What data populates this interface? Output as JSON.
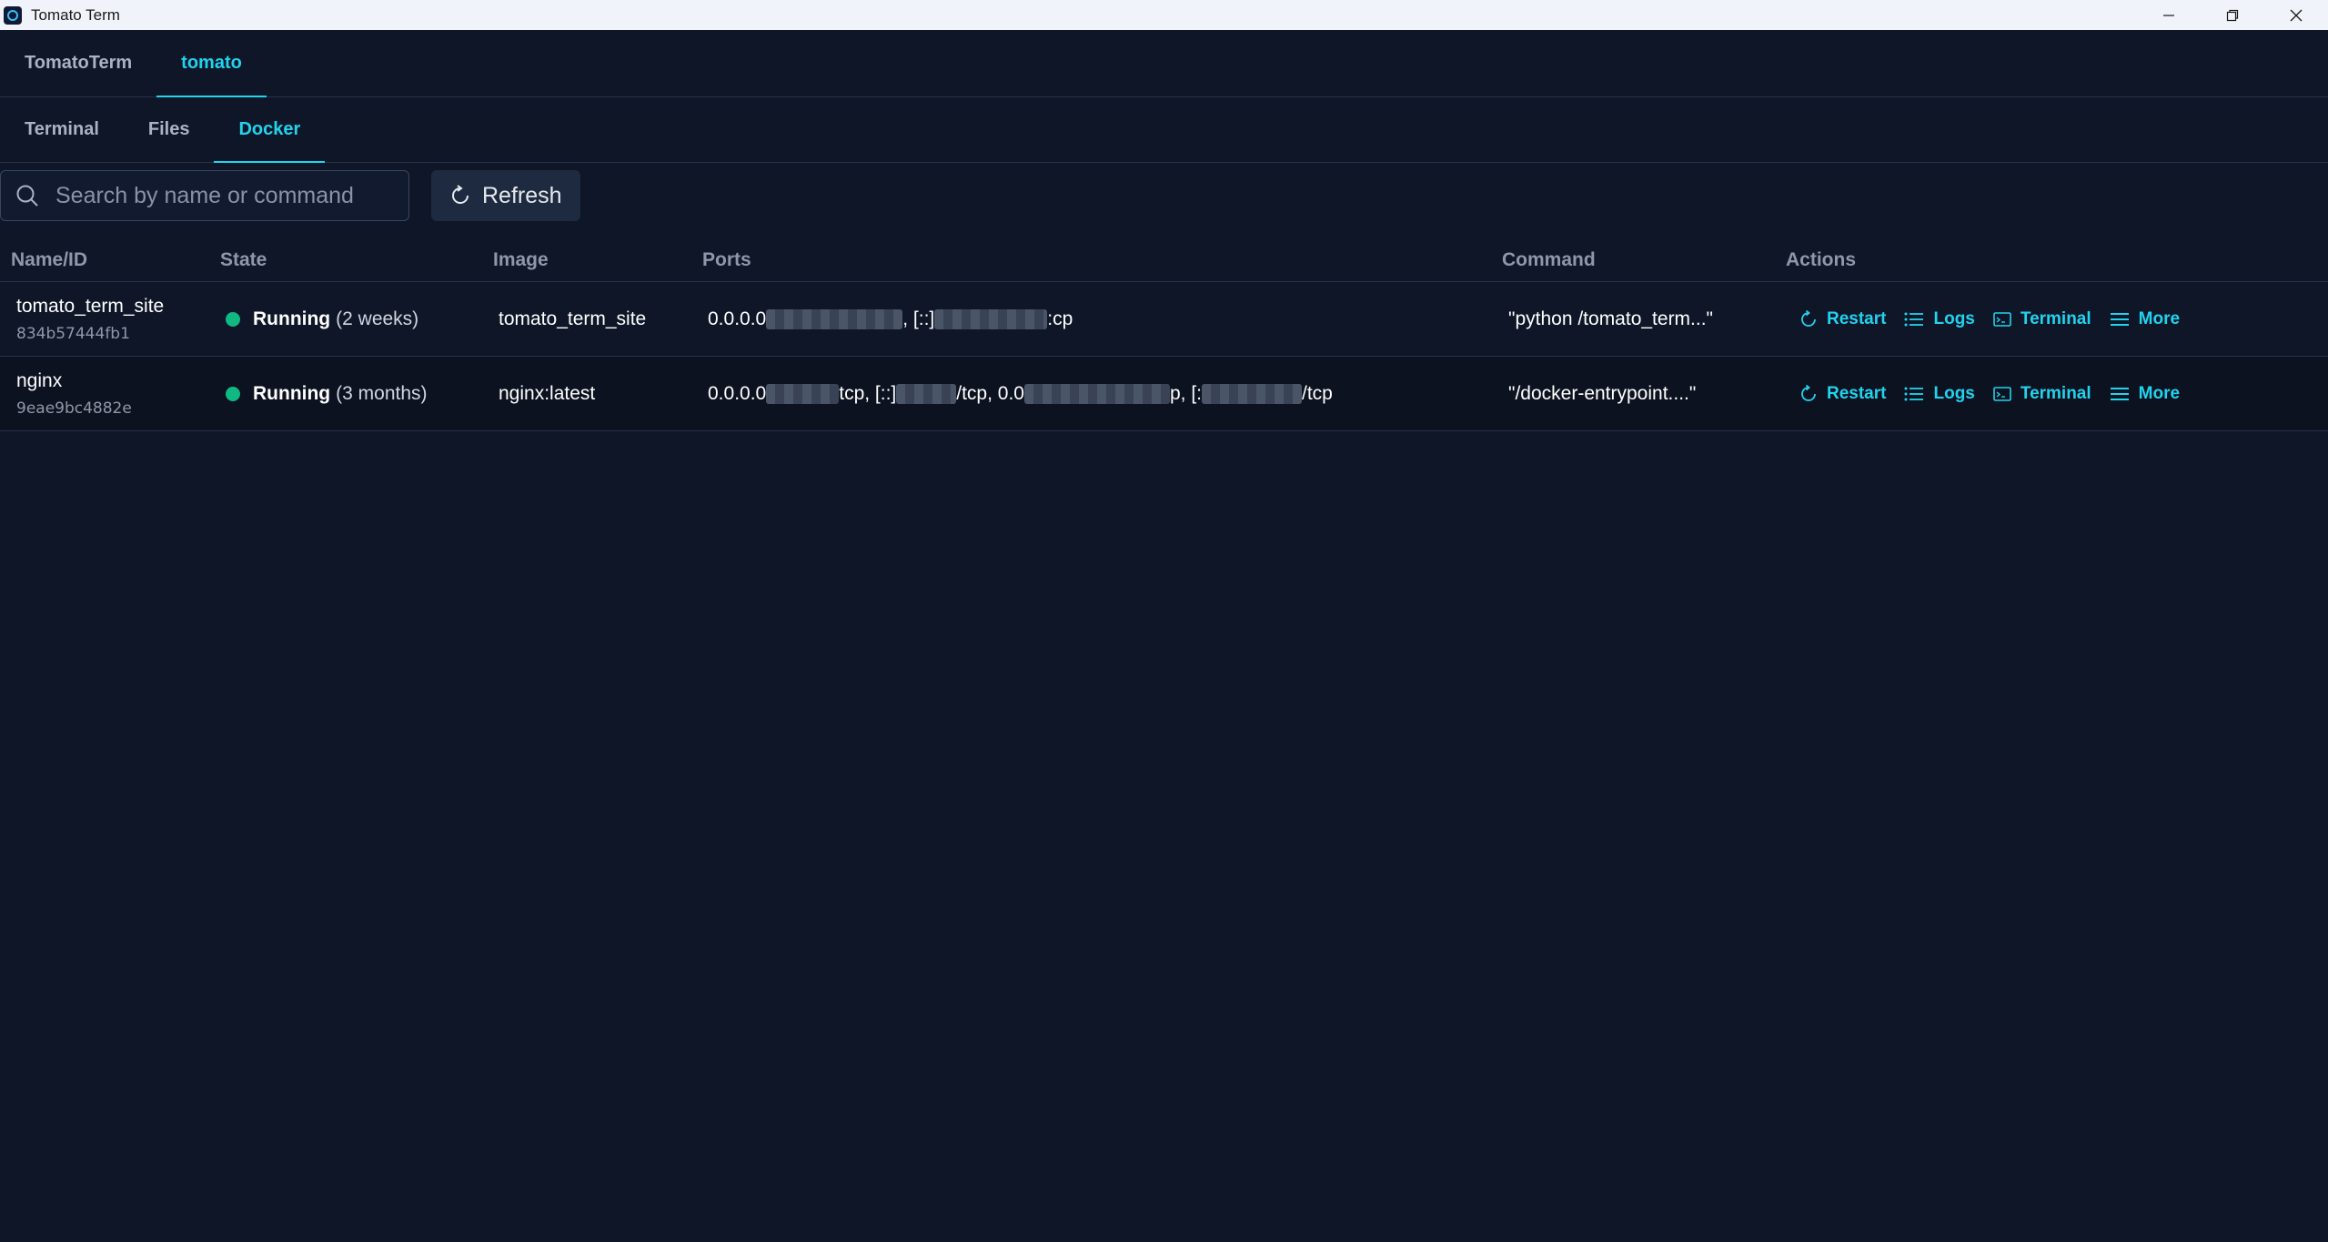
{
  "window": {
    "title": "Tomato Term",
    "controls": [
      "minimize-icon",
      "restore-icon",
      "close-icon"
    ]
  },
  "app_tabs": [
    {
      "label": "TomatoTerm",
      "active": false
    },
    {
      "label": "tomato",
      "active": true
    }
  ],
  "sub_tabs": [
    {
      "label": "Terminal",
      "active": false
    },
    {
      "label": "Files",
      "active": false
    },
    {
      "label": "Docker",
      "active": true
    }
  ],
  "toolbar": {
    "search_placeholder": "Search by name or command",
    "search_value": "",
    "refresh_label": "Refresh"
  },
  "table": {
    "columns": [
      "Name/ID",
      "State",
      "Image",
      "Ports",
      "Command",
      "Actions"
    ],
    "rows": [
      {
        "name": "tomato_term_site",
        "id": "834b57444fb1",
        "state": "Running",
        "duration": "(2 weeks)",
        "image": "tomato_term_site",
        "ports": {
          "p1": "0.0.0.0",
          "p2": ", [::]",
          "p3": ":cp"
        },
        "command": "\"python /tomato_term...\""
      },
      {
        "name": "nginx",
        "id": "9eae9bc4882e",
        "state": "Running",
        "duration": "(3 months)",
        "image": "nginx:latest",
        "ports": {
          "p1": "0.0.0.0",
          "p2": "tcp, [::]",
          "p3": "/tcp, 0.0",
          "p4": "p, [:",
          "p5": "/tcp"
        },
        "command": "\"/docker-entrypoint....\""
      }
    ],
    "actions": [
      "Restart",
      "Logs",
      "Terminal",
      "More"
    ]
  },
  "colors": {
    "background": "#0e1628",
    "accent": "#22d3ee",
    "running": "#10b981"
  }
}
